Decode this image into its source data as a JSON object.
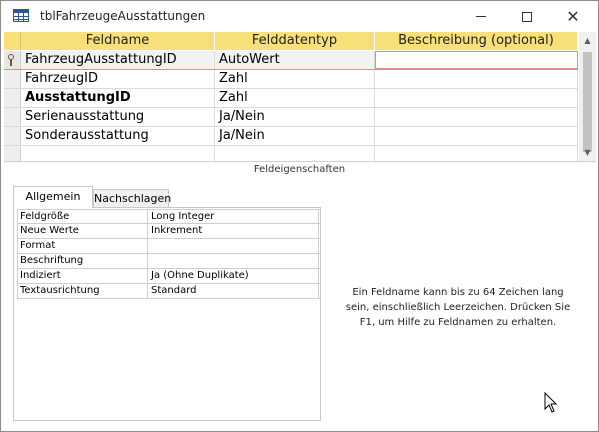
{
  "window": {
    "title": "tblFahrzeugeAusstattungen"
  },
  "grid": {
    "headers": [
      "Feldname",
      "Felddatentyp",
      "Beschreibung (optional)"
    ],
    "rows": [
      {
        "name": "FahrzeugAusstattungID",
        "type": "AutoWert",
        "description": "",
        "primary_key": true
      },
      {
        "name": "FahrzeugID",
        "type": "Zahl",
        "description": ""
      },
      {
        "name": "AusstattungID",
        "type": "Zahl",
        "description": "",
        "bold": true
      },
      {
        "name": "Serienausstattung",
        "type": "Ja/Nein",
        "description": ""
      },
      {
        "name": "Sonderausstattung",
        "type": "Ja/Nein",
        "description": ""
      }
    ]
  },
  "properties": {
    "caption": "Feldeigenschaften",
    "tabs": [
      "Allgemein",
      "Nachschlagen"
    ],
    "rows": [
      {
        "name": "Feldgröße",
        "value": "Long Integer"
      },
      {
        "name": "Neue Werte",
        "value": "Inkrement"
      },
      {
        "name": "Format",
        "value": ""
      },
      {
        "name": "Beschriftung",
        "value": ""
      },
      {
        "name": "Indiziert",
        "value": "Ja (Ohne Duplikate)"
      },
      {
        "name": "Textausrichtung",
        "value": "Standard"
      }
    ],
    "help": "Ein Feldname kann bis zu 64 Zeichen lang sein, einschließlich Leerzeichen. Drücken Sie F1, um Hilfe zu Feldnamen zu erhalten."
  },
  "colors": {
    "header_bg": "#f7e07a",
    "current_row_border": "#e28a8a"
  },
  "icons": [
    "table-icon",
    "minimize-icon",
    "maximize-icon",
    "close-icon",
    "primary-key-icon",
    "scroll-up-icon",
    "scroll-down-icon",
    "mouse-cursor-icon"
  ]
}
